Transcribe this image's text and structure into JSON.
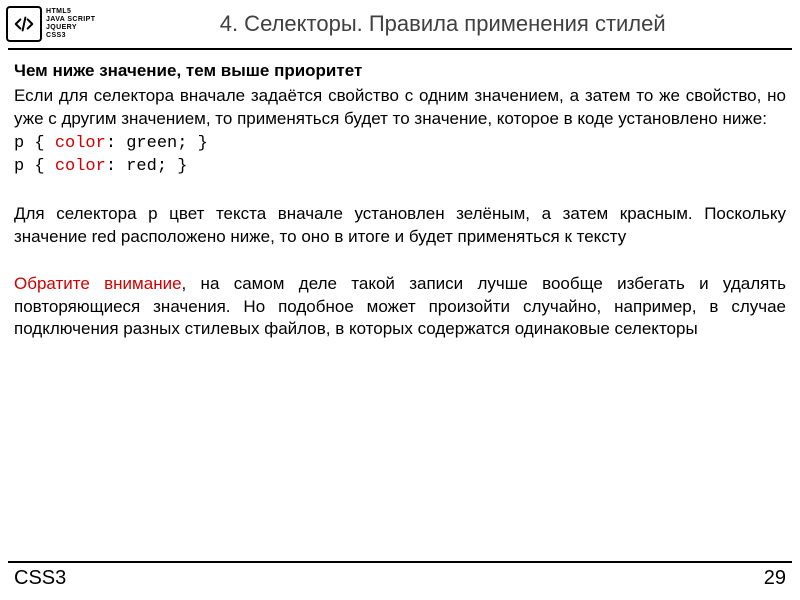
{
  "logo": {
    "lines": [
      "HTML5",
      "JAVA SCRIPT",
      "JQUERY",
      "CSS3"
    ]
  },
  "title": "4. Селекторы. Правила применения стилей",
  "subheading": "Чем ниже значение, тем выше приоритет",
  "para1": "Если для селектора вначале задаётся свойство с одним значением, а затем то же свойство, но уже с другим значением, то применяться будет то значение, которое в коде установлено ниже:",
  "code": {
    "line1_a": "p { ",
    "line1_kw": "color",
    "line1_b": ": green; }",
    "line2_a": "p { ",
    "line2_kw": "color",
    "line2_b": ": red; }"
  },
  "para2": "Для селектора p цвет текста вначале установлен зелёным, а затем красным. Поскольку значение red расположено ниже, то оно в итоге и будет применяться к тексту",
  "attention": "Обратите внимание",
  "para3_rest": ", на самом деле такой записи лучше вообще избегать и удалять повторяющиеся значения. Но подобное может произойти случайно, например, в случае подключения разных стилевых файлов, в которых содержатся одинаковые селекторы",
  "footer": {
    "left": "CSS3",
    "page": "29"
  }
}
